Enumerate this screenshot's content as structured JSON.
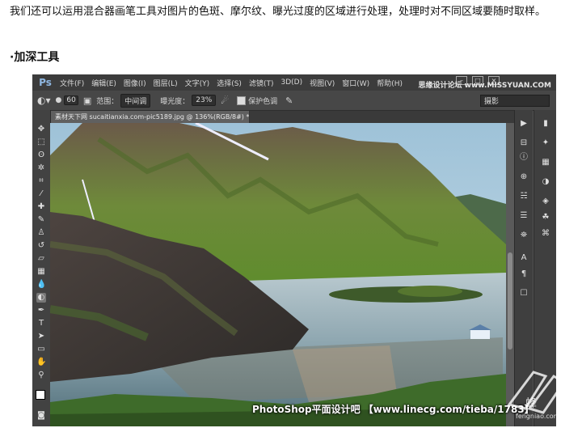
{
  "article": {
    "intro": "我们还可以运用混合器画笔工具对图片的色斑、摩尔纹、曝光过度的区域进行处理，处理时对不同区域要随时取样。",
    "section_title": "·加深工具"
  },
  "ps": {
    "logo": "Ps",
    "menus": [
      "文件(F)",
      "编辑(E)",
      "图像(I)",
      "图层(L)",
      "文字(Y)",
      "选择(S)",
      "滤镜(T)",
      "3D(D)",
      "视图(V)",
      "窗口(W)",
      "帮助(H)"
    ],
    "top_watermark": "思缘设计论坛 www.MISSYUAN.COM",
    "options": {
      "brush_size": "60",
      "range_label": "范围：",
      "range_value": "中间调",
      "exposure_label": "曝光度：",
      "exposure_value": "23%",
      "protect_label": "保护色调",
      "workspace": "摄影"
    },
    "doc_tab": "素材天下网 sucaitianxia.com-pic5189.jpg @ 136%(RGB/8#) *",
    "bottom_watermark": "PhotoShop平面设计吧 【www.linecg.com/tieba/1783】",
    "fx_watermark_line1": "蜂",
    "fx_watermark_line2": "fengniao.com"
  }
}
